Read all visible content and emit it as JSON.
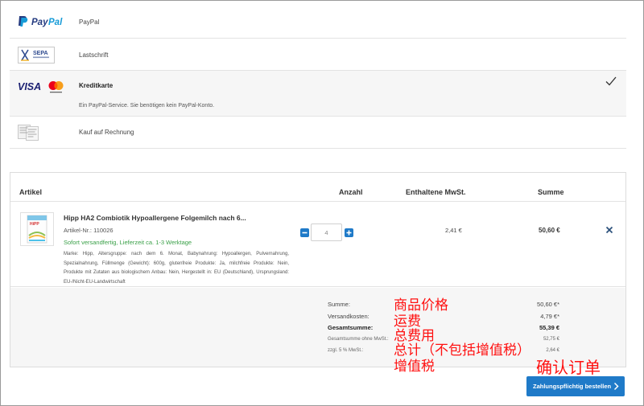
{
  "payment": {
    "methods": [
      {
        "logo": "paypal-logo",
        "label": "PayPal"
      },
      {
        "logo": "sepa-logo",
        "label": "Lastschrift"
      },
      {
        "logo": "visa-mastercard-logo",
        "label": "Kreditkarte",
        "selected": true,
        "description": "Ein PayPal-Service. Sie benötigen kein PayPal-Konto."
      },
      {
        "logo": "invoice-logo",
        "label": "Kauf auf Rechnung"
      }
    ]
  },
  "cart": {
    "headers": {
      "artikel": "Artikel",
      "anzahl": "Anzahl",
      "mwst": "Enthaltene MwSt.",
      "summe": "Summe"
    },
    "item": {
      "title": "Hipp HA2 Combiotik Hypoallergene Folgemilch nach 6...",
      "sku": "Artikel-Nr.: 110026",
      "shipping": "Sofort versandfertig, Lieferzeit ca. 1-3 Werktage",
      "description": "Marke: Hipp, Altersgruppe: nach dem 6. Monat, Babynahrung: Hypoallergen, Pulvernahrung, Spezialnahrung, Füllmenge (Gewicht): 600g, glutenfreie Produkte: Ja, milchfreie Produkte: Nein, Produkte mit Zutaten aus biologischem Anbau: Nein, Hergestellt in: EU (Deutschland), Ursprungsland: EU-/Nicht-EU-Landwirtschaft",
      "quantity": "4",
      "mwst": "2,41 €",
      "sum": "50,60 €"
    },
    "totals": [
      {
        "label": "Summe:",
        "value": "50,60 €*"
      },
      {
        "label": "Versandkosten:",
        "value": "4,79 €*"
      },
      {
        "label": "Gesamtsumme:",
        "value": "55,39 €"
      },
      {
        "label": "Gesamtsumme ohne MwSt.:",
        "value": "52,75 €"
      },
      {
        "label": "zzgl. 5 % MwSt.:",
        "value": "2,64 €"
      }
    ]
  },
  "annotations": {
    "price": "商品价格",
    "shipping": "运费",
    "total": "总费用",
    "net": "总计（不包括增值税）",
    "vat": "增值税",
    "confirm": "确认订单"
  },
  "confirm_button": {
    "label": "Zahlungspflichtig bestellen"
  },
  "colors": {
    "accent": "#1f7ac8",
    "in_stock": "#3aa048",
    "annotation": "#ff1111"
  }
}
